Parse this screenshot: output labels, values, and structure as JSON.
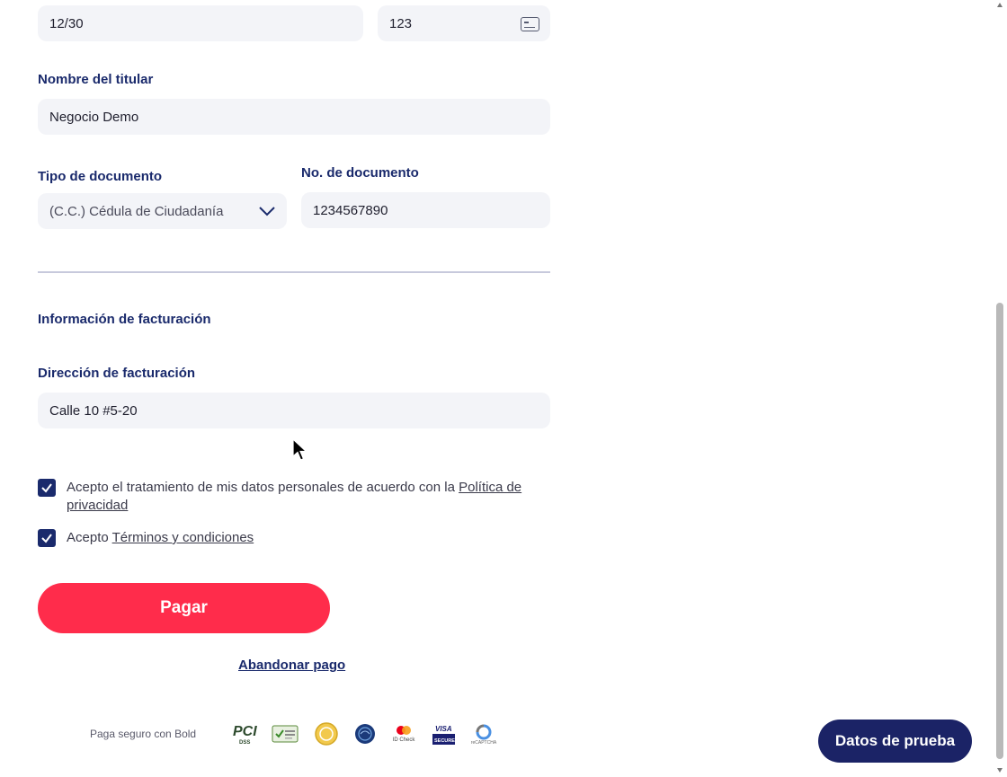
{
  "form": {
    "expiry_value": "12/30",
    "cvv_value": "123",
    "holder_label": "Nombre del titular",
    "holder_value": "Negocio Demo",
    "doc_type_label": "Tipo de documento",
    "doc_type_value": "(C.C.) Cédula de Ciudadanía",
    "doc_number_label": "No. de documento",
    "doc_number_value": "1234567890"
  },
  "billing": {
    "section_title": "Información de facturación",
    "address_label": "Dirección de facturación",
    "address_value": "Calle 10 #5-20"
  },
  "consents": {
    "privacy_prefix": "Acepto el tratamiento de mis datos personales de acuerdo con la ",
    "privacy_link": "Política de privacidad",
    "privacy_checked": true,
    "terms_prefix": "Acepto ",
    "terms_link": "Términos y condiciones",
    "terms_checked": true
  },
  "actions": {
    "pay_label": "Pagar",
    "abandon_label": "Abandonar pago",
    "test_data_label": "Datos de prueba"
  },
  "footer": {
    "secure_text": "Paga seguro con Bold",
    "badges": [
      "pci-dss-icon",
      "safe-badge-icon",
      "bold-coin-icon",
      "pse-icon",
      "mastercard-id-check-icon",
      "visa-secure-icon",
      "recaptcha-icon"
    ],
    "pci_text": "PCI",
    "pci_sub": "DSS",
    "id_check_text": "ID Check",
    "visa_text": "VISA",
    "visa_secure_text": "SECURE",
    "recaptcha_text": "reCAPTCHA"
  },
  "colors": {
    "primary_navy": "#1a2a6c",
    "pay_red": "#ff2c4b",
    "field_bg": "#f3f4f8"
  }
}
